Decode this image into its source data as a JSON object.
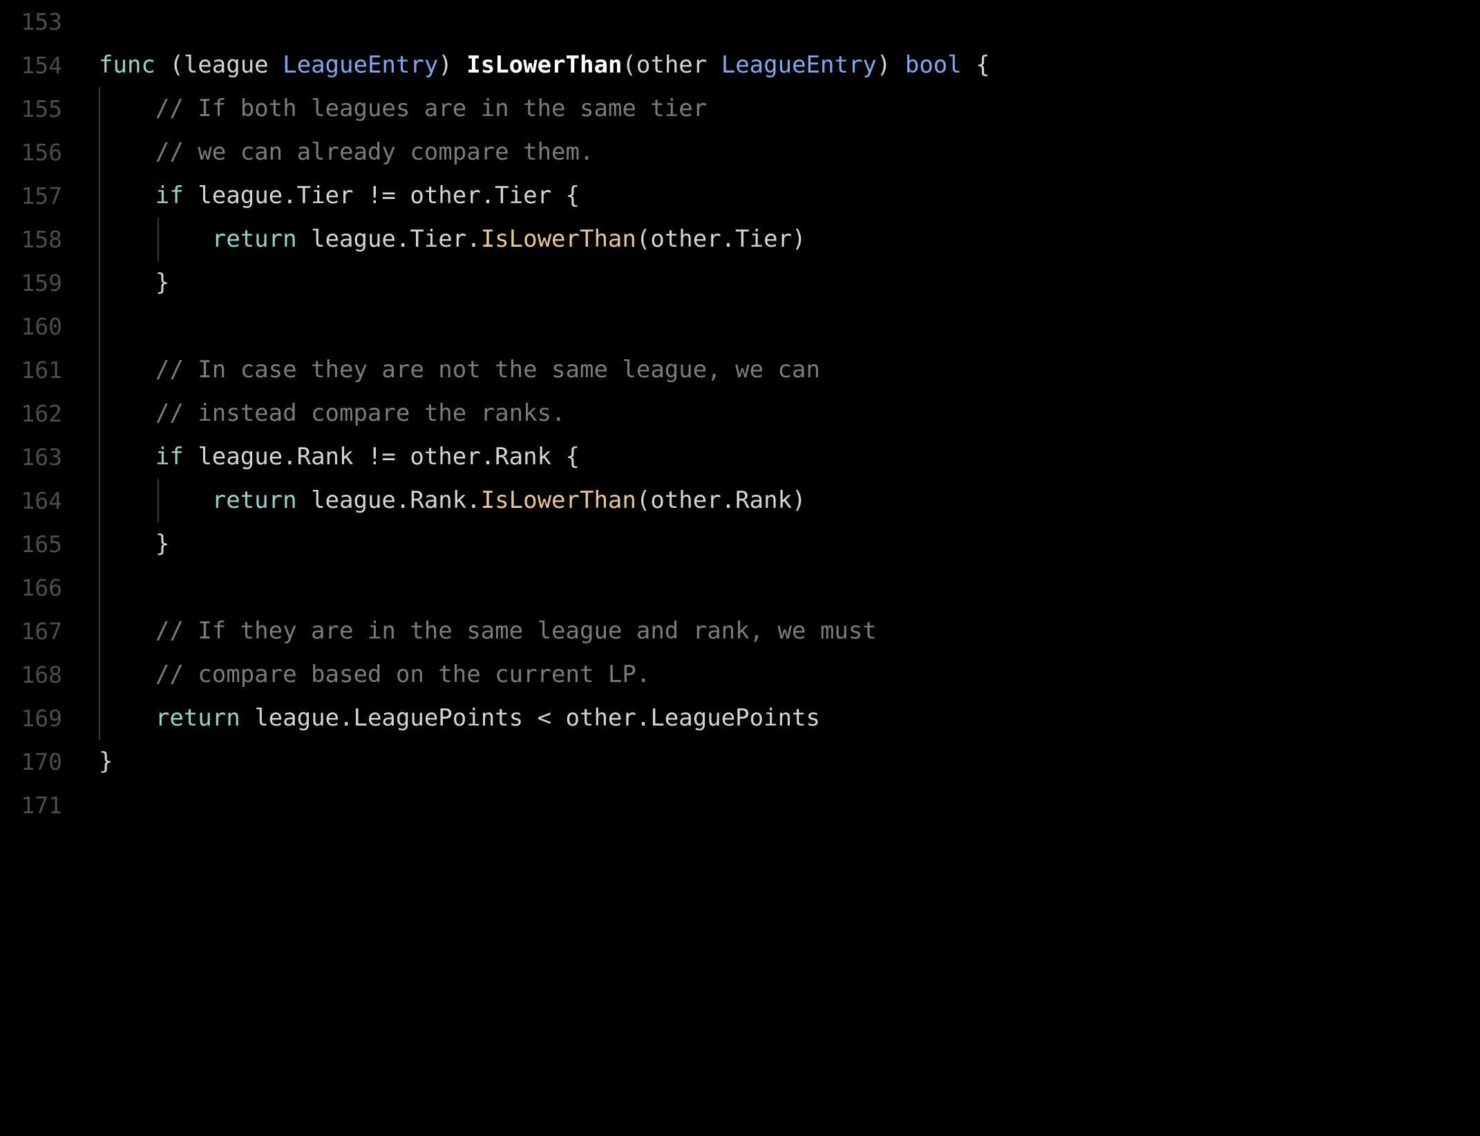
{
  "editor": {
    "background_color": "#000000",
    "language": "go",
    "font_size_px": 34,
    "line_height_px": 63,
    "gutter": {
      "first_line_number": 153,
      "last_line_number": 171,
      "number_color": "#4d4d4d"
    },
    "colors": {
      "keyword": "#8ed6cd",
      "type": "#7aaaee",
      "function_declaration": "#ffffff",
      "function_call": "#e8c792",
      "comment": "#7b7b7b",
      "plain": "#d6d4ce",
      "indent_guide": "#3a3a3a"
    },
    "lines": [
      {
        "number": "153",
        "tokens": []
      },
      {
        "number": "154",
        "tokens": [
          {
            "text": "func",
            "kind": "keyword"
          },
          {
            "text": " (league ",
            "kind": "plain"
          },
          {
            "text": "LeagueEntry",
            "kind": "type"
          },
          {
            "text": ") ",
            "kind": "plain"
          },
          {
            "text": "IsLowerThan",
            "kind": "funcdecl"
          },
          {
            "text": "(other ",
            "kind": "plain"
          },
          {
            "text": "LeagueEntry",
            "kind": "type"
          },
          {
            "text": ") ",
            "kind": "plain"
          },
          {
            "text": "bool",
            "kind": "type"
          },
          {
            "text": " {",
            "kind": "plain"
          }
        ]
      },
      {
        "number": "155",
        "tokens": [
          {
            "text": "    // If both leagues are in the same tier",
            "kind": "comment"
          }
        ]
      },
      {
        "number": "156",
        "tokens": [
          {
            "text": "    // we can already compare them.",
            "kind": "comment"
          }
        ]
      },
      {
        "number": "157",
        "tokens": [
          {
            "text": "    ",
            "kind": "plain"
          },
          {
            "text": "if",
            "kind": "keyword"
          },
          {
            "text": " league.Tier != other.Tier {",
            "kind": "plain"
          }
        ]
      },
      {
        "number": "158",
        "tokens": [
          {
            "text": "        ",
            "kind": "plain"
          },
          {
            "text": "return",
            "kind": "keyword"
          },
          {
            "text": " league.Tier.",
            "kind": "plain"
          },
          {
            "text": "IsLowerThan",
            "kind": "funccall"
          },
          {
            "text": "(other.Tier)",
            "kind": "plain"
          }
        ]
      },
      {
        "number": "159",
        "tokens": [
          {
            "text": "    }",
            "kind": "plain"
          }
        ]
      },
      {
        "number": "160",
        "tokens": []
      },
      {
        "number": "161",
        "tokens": [
          {
            "text": "    // In case they are not the same league, we can",
            "kind": "comment"
          }
        ]
      },
      {
        "number": "162",
        "tokens": [
          {
            "text": "    // instead compare the ranks.",
            "kind": "comment"
          }
        ]
      },
      {
        "number": "163",
        "tokens": [
          {
            "text": "    ",
            "kind": "plain"
          },
          {
            "text": "if",
            "kind": "keyword"
          },
          {
            "text": " league.Rank != other.Rank {",
            "kind": "plain"
          }
        ]
      },
      {
        "number": "164",
        "tokens": [
          {
            "text": "        ",
            "kind": "plain"
          },
          {
            "text": "return",
            "kind": "keyword"
          },
          {
            "text": " league.Rank.",
            "kind": "plain"
          },
          {
            "text": "IsLowerThan",
            "kind": "funccall"
          },
          {
            "text": "(other.Rank)",
            "kind": "plain"
          }
        ]
      },
      {
        "number": "165",
        "tokens": [
          {
            "text": "    }",
            "kind": "plain"
          }
        ]
      },
      {
        "number": "166",
        "tokens": []
      },
      {
        "number": "167",
        "tokens": [
          {
            "text": "    // If they are in the same league and rank, we must",
            "kind": "comment"
          }
        ]
      },
      {
        "number": "168",
        "tokens": [
          {
            "text": "    // compare based on the current LP.",
            "kind": "comment"
          }
        ]
      },
      {
        "number": "169",
        "tokens": [
          {
            "text": "    ",
            "kind": "plain"
          },
          {
            "text": "return",
            "kind": "keyword"
          },
          {
            "text": " league.LeaguePoints < other.LeaguePoints",
            "kind": "plain"
          }
        ]
      },
      {
        "number": "170",
        "tokens": [
          {
            "text": "}",
            "kind": "plain"
          }
        ]
      },
      {
        "number": "171",
        "tokens": []
      }
    ]
  }
}
